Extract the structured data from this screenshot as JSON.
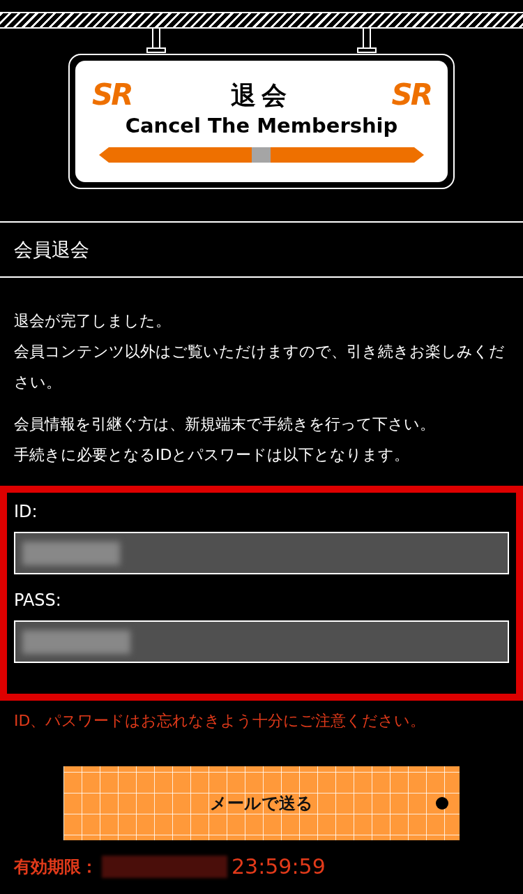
{
  "sign": {
    "logos": [
      "SR",
      "SR"
    ],
    "title": "退会",
    "subtitle": "Cancel The Membership"
  },
  "section_title": "会員退会",
  "paragraphs": [
    [
      "退会が完了しました。",
      "会員コンテンツ以外はご覧いただけますので、引き続きお楽しみください。"
    ],
    [
      "会員情報を引継ぐ方は、新規端末で手続きを行って下さい。",
      "手続きに必要となるIDとパスワードは以下となります。"
    ]
  ],
  "credentials": [
    {
      "label": "ID:"
    },
    {
      "label": "PASS:"
    }
  ],
  "warning": "ID、パスワードはお忘れなきよう十分にご注意ください。",
  "button": {
    "label": "メールで送る"
  },
  "expiry": {
    "label": "有効期限：",
    "time": "23:59:59"
  }
}
